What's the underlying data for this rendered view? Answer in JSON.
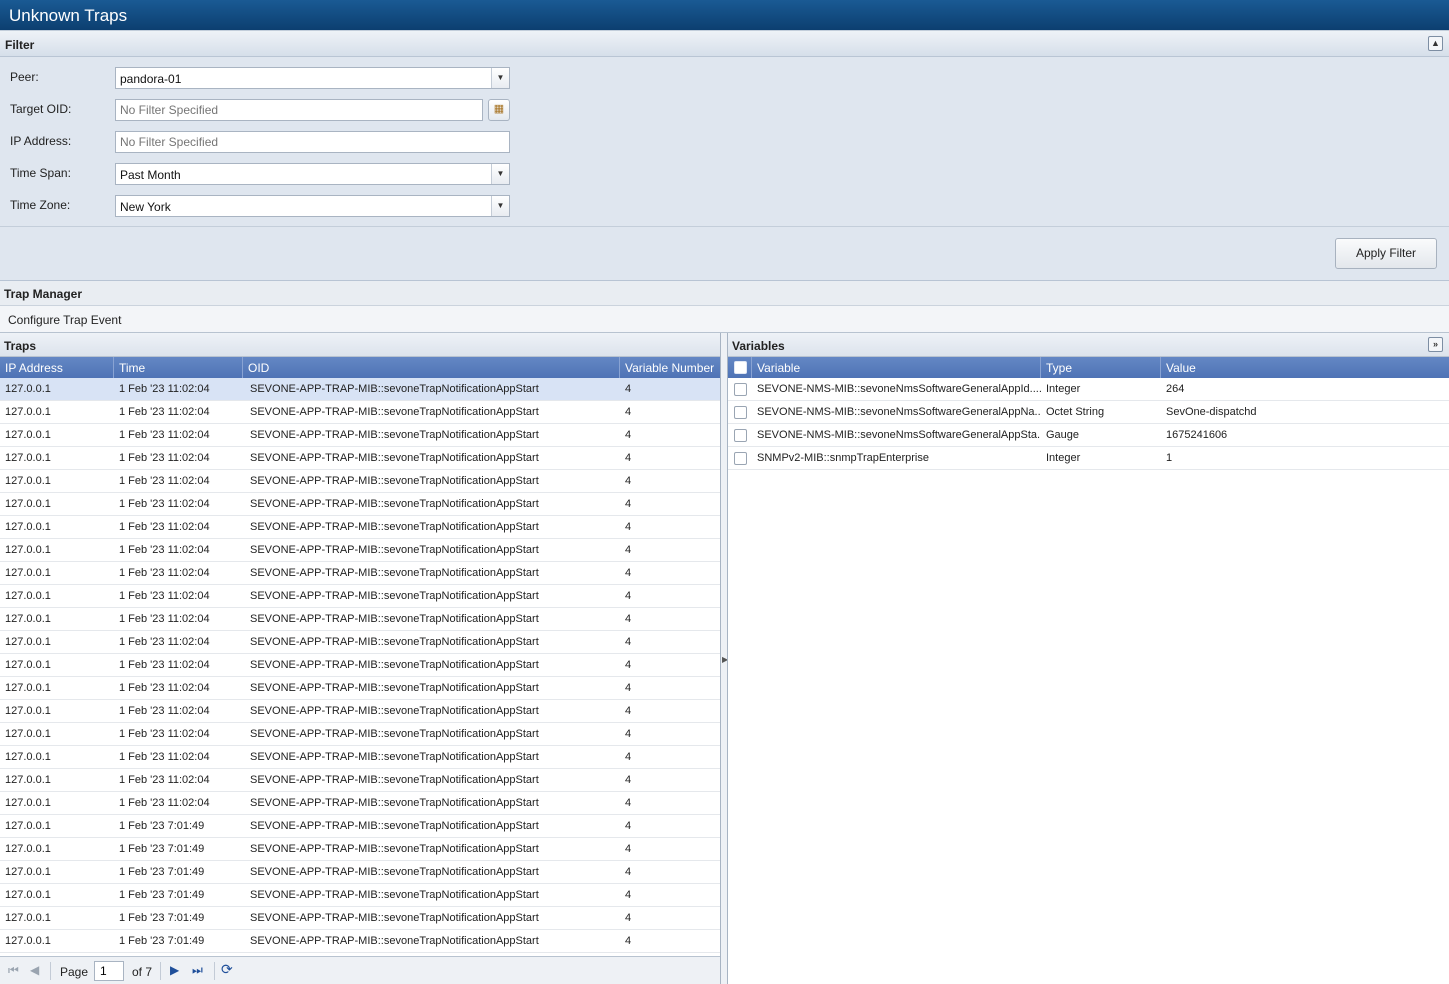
{
  "window": {
    "title": "Unknown Traps"
  },
  "filter": {
    "header": "Filter",
    "collapse_icon": "collapse-up-icon",
    "fields": {
      "peer": {
        "label": "Peer:",
        "value": "pandora-01"
      },
      "target_oid": {
        "label": "Target OID:",
        "placeholder": "No Filter Specified"
      },
      "ip_address": {
        "label": "IP Address:",
        "placeholder": "No Filter Specified"
      },
      "time_span": {
        "label": "Time Span:",
        "value": "Past Month"
      },
      "time_zone": {
        "label": "Time Zone:",
        "value": "New York"
      }
    },
    "apply_label": "Apply Filter"
  },
  "trap_manager": {
    "header": "Trap Manager",
    "toolbar": {
      "configure_label": "Configure Trap Event"
    }
  },
  "traps": {
    "header": "Traps",
    "columns": [
      "IP Address",
      "Time",
      "OID",
      "Variable Number"
    ],
    "rows": [
      [
        "127.0.0.1",
        "1 Feb '23 11:02:04",
        "SEVONE-APP-TRAP-MIB::sevoneTrapNotificationAppStart",
        "4"
      ],
      [
        "127.0.0.1",
        "1 Feb '23 11:02:04",
        "SEVONE-APP-TRAP-MIB::sevoneTrapNotificationAppStart",
        "4"
      ],
      [
        "127.0.0.1",
        "1 Feb '23 11:02:04",
        "SEVONE-APP-TRAP-MIB::sevoneTrapNotificationAppStart",
        "4"
      ],
      [
        "127.0.0.1",
        "1 Feb '23 11:02:04",
        "SEVONE-APP-TRAP-MIB::sevoneTrapNotificationAppStart",
        "4"
      ],
      [
        "127.0.0.1",
        "1 Feb '23 11:02:04",
        "SEVONE-APP-TRAP-MIB::sevoneTrapNotificationAppStart",
        "4"
      ],
      [
        "127.0.0.1",
        "1 Feb '23 11:02:04",
        "SEVONE-APP-TRAP-MIB::sevoneTrapNotificationAppStart",
        "4"
      ],
      [
        "127.0.0.1",
        "1 Feb '23 11:02:04",
        "SEVONE-APP-TRAP-MIB::sevoneTrapNotificationAppStart",
        "4"
      ],
      [
        "127.0.0.1",
        "1 Feb '23 11:02:04",
        "SEVONE-APP-TRAP-MIB::sevoneTrapNotificationAppStart",
        "4"
      ],
      [
        "127.0.0.1",
        "1 Feb '23 11:02:04",
        "SEVONE-APP-TRAP-MIB::sevoneTrapNotificationAppStart",
        "4"
      ],
      [
        "127.0.0.1",
        "1 Feb '23 11:02:04",
        "SEVONE-APP-TRAP-MIB::sevoneTrapNotificationAppStart",
        "4"
      ],
      [
        "127.0.0.1",
        "1 Feb '23 11:02:04",
        "SEVONE-APP-TRAP-MIB::sevoneTrapNotificationAppStart",
        "4"
      ],
      [
        "127.0.0.1",
        "1 Feb '23 11:02:04",
        "SEVONE-APP-TRAP-MIB::sevoneTrapNotificationAppStart",
        "4"
      ],
      [
        "127.0.0.1",
        "1 Feb '23 11:02:04",
        "SEVONE-APP-TRAP-MIB::sevoneTrapNotificationAppStart",
        "4"
      ],
      [
        "127.0.0.1",
        "1 Feb '23 11:02:04",
        "SEVONE-APP-TRAP-MIB::sevoneTrapNotificationAppStart",
        "4"
      ],
      [
        "127.0.0.1",
        "1 Feb '23 11:02:04",
        "SEVONE-APP-TRAP-MIB::sevoneTrapNotificationAppStart",
        "4"
      ],
      [
        "127.0.0.1",
        "1 Feb '23 11:02:04",
        "SEVONE-APP-TRAP-MIB::sevoneTrapNotificationAppStart",
        "4"
      ],
      [
        "127.0.0.1",
        "1 Feb '23 11:02:04",
        "SEVONE-APP-TRAP-MIB::sevoneTrapNotificationAppStart",
        "4"
      ],
      [
        "127.0.0.1",
        "1 Feb '23 11:02:04",
        "SEVONE-APP-TRAP-MIB::sevoneTrapNotificationAppStart",
        "4"
      ],
      [
        "127.0.0.1",
        "1 Feb '23 11:02:04",
        "SEVONE-APP-TRAP-MIB::sevoneTrapNotificationAppStart",
        "4"
      ],
      [
        "127.0.0.1",
        "1 Feb '23 7:01:49",
        "SEVONE-APP-TRAP-MIB::sevoneTrapNotificationAppStart",
        "4"
      ],
      [
        "127.0.0.1",
        "1 Feb '23 7:01:49",
        "SEVONE-APP-TRAP-MIB::sevoneTrapNotificationAppStart",
        "4"
      ],
      [
        "127.0.0.1",
        "1 Feb '23 7:01:49",
        "SEVONE-APP-TRAP-MIB::sevoneTrapNotificationAppStart",
        "4"
      ],
      [
        "127.0.0.1",
        "1 Feb '23 7:01:49",
        "SEVONE-APP-TRAP-MIB::sevoneTrapNotificationAppStart",
        "4"
      ],
      [
        "127.0.0.1",
        "1 Feb '23 7:01:49",
        "SEVONE-APP-TRAP-MIB::sevoneTrapNotificationAppStart",
        "4"
      ],
      [
        "127.0.0.1",
        "1 Feb '23 7:01:49",
        "SEVONE-APP-TRAP-MIB::sevoneTrapNotificationAppStart",
        "4"
      ]
    ],
    "selected_row": 0,
    "pager": {
      "page_label": "Page",
      "current_page": "1",
      "of_label": "of 7"
    }
  },
  "variables": {
    "header": "Variables",
    "columns": [
      "Variable",
      "Type",
      "Value"
    ],
    "rows": [
      [
        "SEVONE-NMS-MIB::sevoneNmsSoftwareGeneralAppId....",
        "Integer",
        "264"
      ],
      [
        "SEVONE-NMS-MIB::sevoneNmsSoftwareGeneralAppNa...",
        "Octet String",
        "SevOne-dispatchd"
      ],
      [
        "SEVONE-NMS-MIB::sevoneNmsSoftwareGeneralAppSta...",
        "Gauge",
        "1675241606"
      ],
      [
        "SNMPv2-MIB::snmpTrapEnterprise",
        "Integer",
        "1"
      ]
    ]
  },
  "colors": {
    "titlebar": "#0c3f70",
    "grid_header": "#5a7dbd",
    "selected_row": "#d8e3f5",
    "panel_bg": "#dfe6ef"
  }
}
